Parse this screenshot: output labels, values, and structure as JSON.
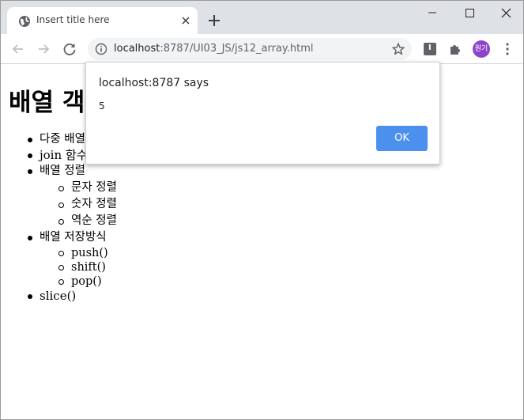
{
  "browser": {
    "tab": {
      "title": "Insert title here",
      "favicon": "globe-icon"
    },
    "new_tab_label": "+",
    "address": {
      "url_host": "localhost",
      "url_rest": ":8787/UI03_JS/js12_array.html"
    },
    "extension_label": "I",
    "profile_label": "원기",
    "colors": {
      "tabstrip": "#dee1e6",
      "accent": "#4a90ec",
      "avatar": "#8e44c9"
    }
  },
  "page": {
    "heading": "배열 객",
    "items": [
      {
        "label": "다중 배열",
        "kr": true,
        "children": []
      },
      {
        "label": "join 함수",
        "kr": false,
        "children": []
      },
      {
        "label": "배열 정렬",
        "kr": true,
        "children": [
          {
            "label": "문자 정렬",
            "kr": true
          },
          {
            "label": "숫자 정렬",
            "kr": true
          },
          {
            "label": "역순 정렬",
            "kr": true
          }
        ]
      },
      {
        "label": "배열 저장방식",
        "kr": true,
        "children": [
          {
            "label": "push()",
            "kr": false
          },
          {
            "label": "shift()",
            "kr": false
          },
          {
            "label": "pop()",
            "kr": false
          }
        ]
      },
      {
        "label": "slice()",
        "kr": false,
        "children": []
      }
    ]
  },
  "dialog": {
    "title": "localhost:8787 says",
    "message": "5",
    "ok_label": "OK"
  }
}
